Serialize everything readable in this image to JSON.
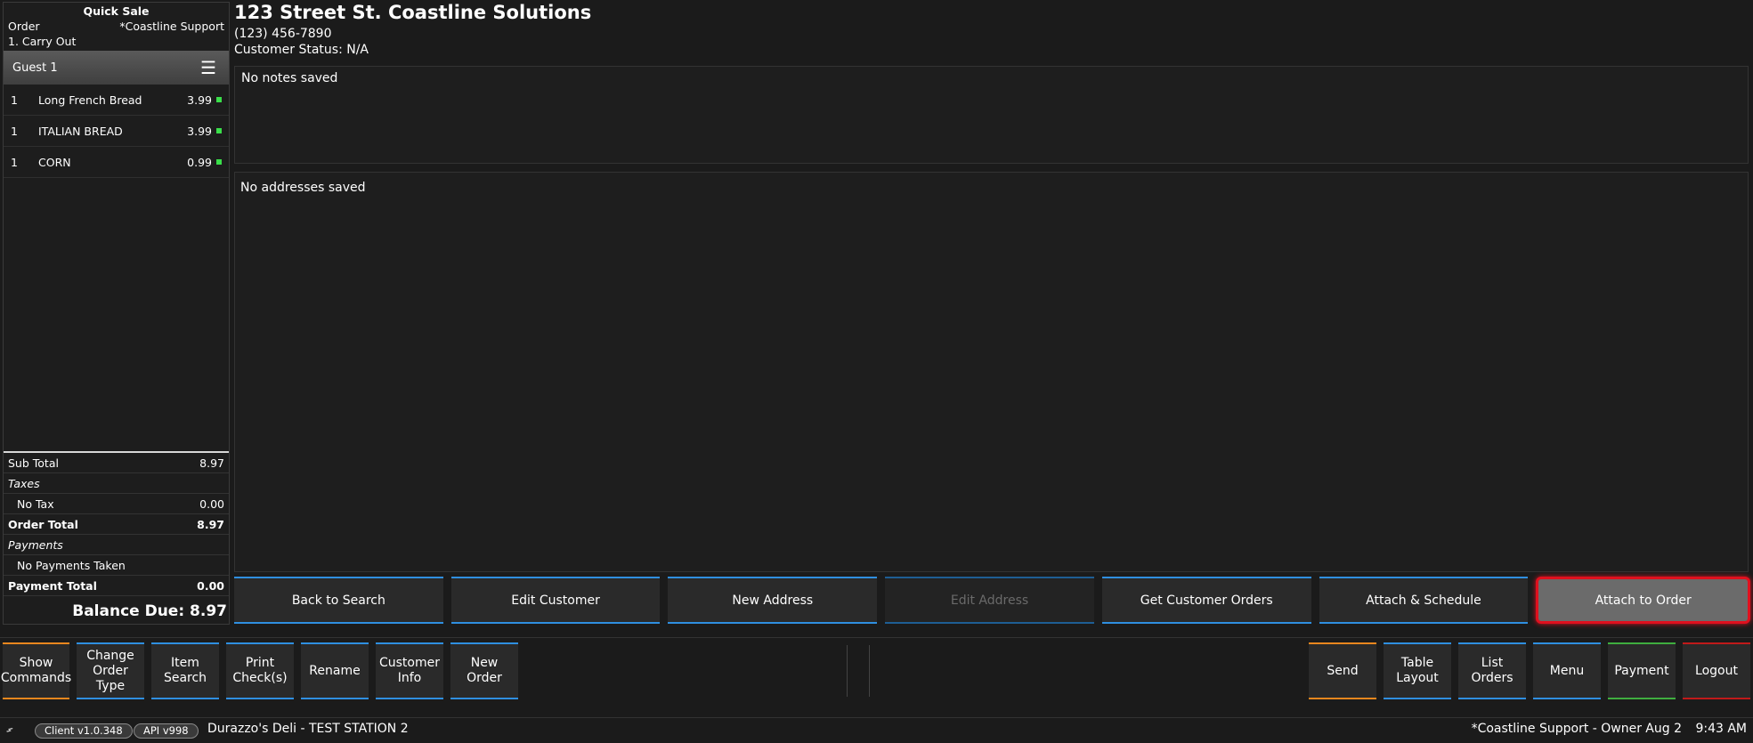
{
  "order_panel": {
    "title": "Quick Sale",
    "order_label": "Order",
    "employee": "*Coastline Support",
    "order_type": "1. Carry Out",
    "guest_label": "Guest 1",
    "items": [
      {
        "qty": "1",
        "name": "Long French Bread",
        "price": "3.99"
      },
      {
        "qty": "1",
        "name": "ITALIAN BREAD",
        "price": "3.99"
      },
      {
        "qty": "1",
        "name": "CORN",
        "price": "0.99"
      }
    ],
    "subtotal_label": "Sub Total",
    "subtotal": "8.97",
    "taxes_label": "Taxes",
    "no_tax_label": "No Tax",
    "no_tax_value": "0.00",
    "order_total_label": "Order Total",
    "order_total": "8.97",
    "payments_label": "Payments",
    "no_payments_label": "No Payments Taken",
    "payment_total_label": "Payment Total",
    "payment_total": "0.00",
    "balance_due": "Balance Due: 8.97"
  },
  "customer": {
    "name": "123 Street St. Coastline Solutions",
    "phone": "(123) 456-7890",
    "status": "Customer Status: N/A",
    "notes": "No notes saved",
    "addresses": "No addresses saved"
  },
  "actions": {
    "back_to_search": "Back to Search",
    "edit_customer": "Edit Customer",
    "new_address": "New Address",
    "edit_address": "Edit Address",
    "get_customer_orders": "Get Customer Orders",
    "attach_schedule": "Attach & Schedule",
    "attach_to_order": "Attach to Order"
  },
  "commands": {
    "show_commands": "Show\nCommands",
    "change_order_type": "Change\nOrder\nType",
    "item_search": "Item\nSearch",
    "print_checks": "Print\nCheck(s)",
    "rename": "Rename",
    "customer_info": "Customer\nInfo",
    "new_order": "New\nOrder",
    "send": "Send",
    "table_layout": "Table\nLayout",
    "list_orders": "List\nOrders",
    "menu": "Menu",
    "payment": "Payment",
    "logout": "Logout"
  },
  "status_bar": {
    "client_version": "Client v1.0.348",
    "api_version": "API v998",
    "station": "Durazzo's Deli - TEST STATION 2",
    "user": "*Coastline Support - Owner",
    "date": "Aug 2",
    "time": "9:43 AM"
  },
  "colors": {
    "blue_accent": "#2f8fe0",
    "orange_accent": "#e8871e",
    "green_accent": "#3fae3f",
    "red_accent": "#c01a1a",
    "highlight_border": "#e0101e",
    "item_indicator": "#3adf4a"
  }
}
